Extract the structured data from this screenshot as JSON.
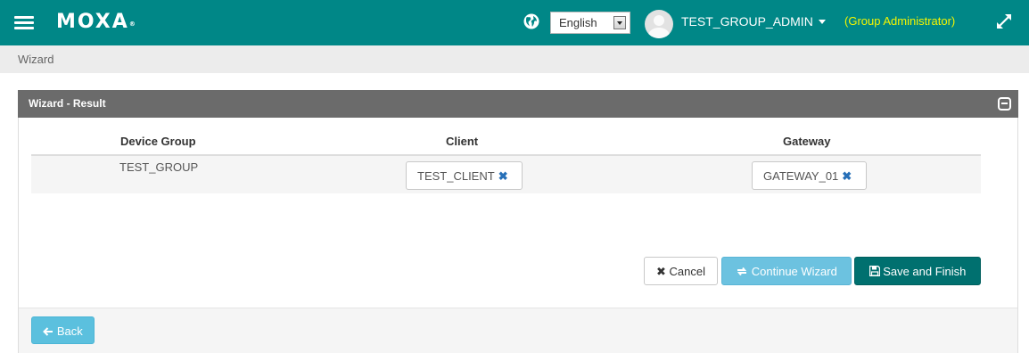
{
  "topbar": {
    "brand": "MOXA",
    "brand_mark": "®",
    "language": "English",
    "username": "TEST_GROUP_ADMIN",
    "role": "(Group Administrator)",
    "color": "#008787"
  },
  "breadcrumb": {
    "current": "Wizard"
  },
  "panel": {
    "title": "Wizard - Result",
    "columns": [
      "Device Group",
      "Client",
      "Gateway"
    ],
    "row": {
      "device_group": "TEST_GROUP",
      "client": "TEST_CLIENT",
      "gateway": "GATEWAY_01"
    }
  },
  "buttons": {
    "cancel": "Cancel",
    "continue": "Continue Wizard",
    "save": "Save and Finish",
    "back": "Back"
  },
  "icons": [
    "menu-icon",
    "globe-icon",
    "dropdown-arrow-icon",
    "avatar-icon",
    "caret-down-icon",
    "expand-icon",
    "collapse-icon",
    "remove-icon",
    "times-icon",
    "refresh-icon",
    "save-icon",
    "arrow-left-icon"
  ]
}
